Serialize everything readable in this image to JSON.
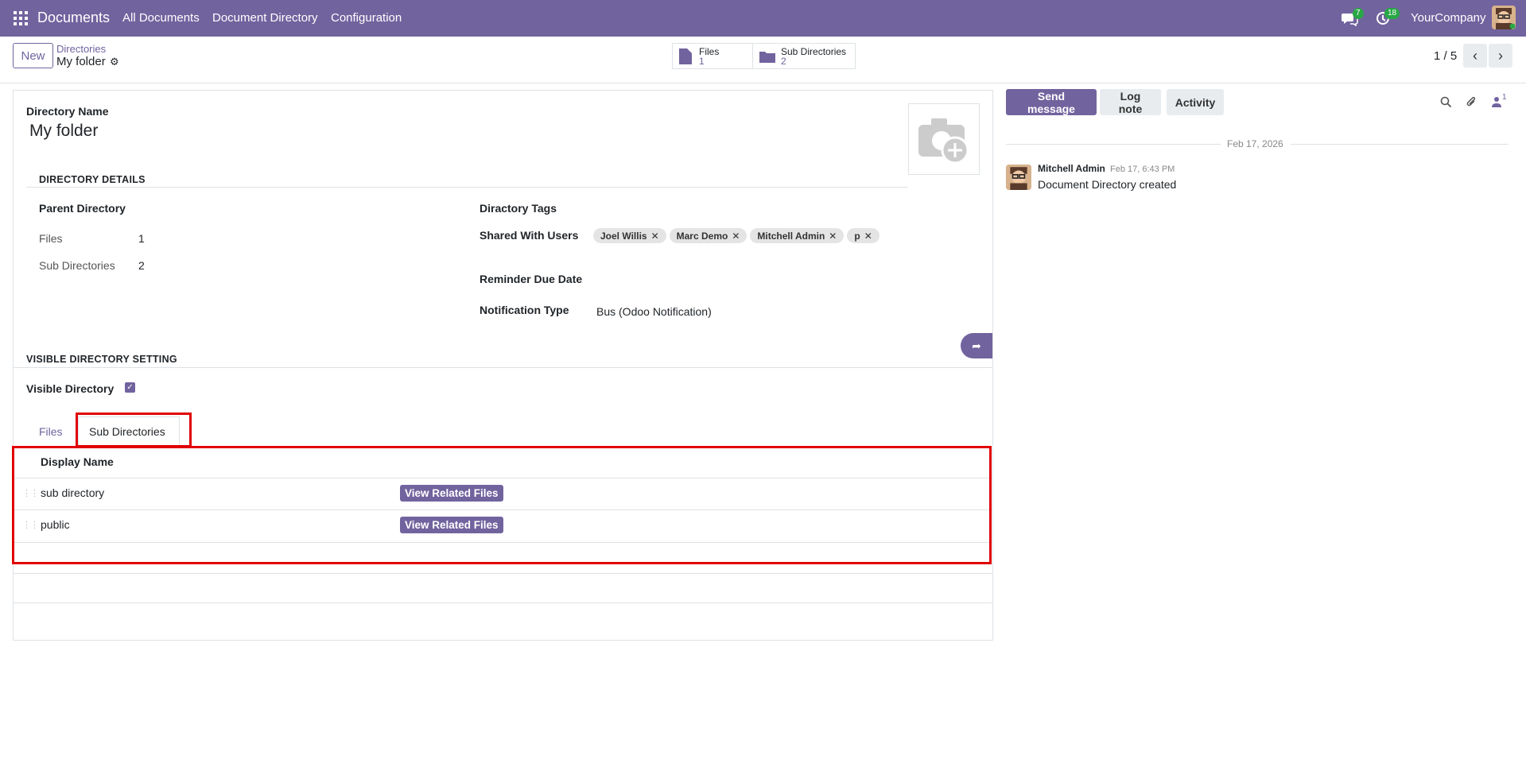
{
  "topbar": {
    "app_name": "Documents",
    "menus": [
      "All Documents",
      "Document Directory",
      "Configuration"
    ],
    "messages_badge": "7",
    "activities_badge": "18",
    "company": "YourCompany"
  },
  "control_panel": {
    "new_label": "New",
    "breadcrumb_parent": "Directories",
    "breadcrumb_current": "My folder",
    "smart_buttons": [
      {
        "label": "Files",
        "count": "1"
      },
      {
        "label": "Sub Directories",
        "count": "2"
      }
    ],
    "pager": "1 / 5"
  },
  "form": {
    "name_label": "Directory Name",
    "name_value": "My folder",
    "section_details": "DIRECTORY DETAILS",
    "parent_label": "Parent Directory",
    "files_label": "Files",
    "files_value": "1",
    "subdirs_label": "Sub Directories",
    "subdirs_value": "2",
    "tags_label": "Diractory Tags",
    "shared_label": "Shared With Users",
    "shared_users": [
      "Joel Willis",
      "Marc Demo",
      "Mitchell Admin",
      "p"
    ],
    "reminder_label": "Reminder Due Date",
    "notif_label": "Notification Type",
    "notif_value": "Bus (Odoo Notification)",
    "section_visible": "VISIBLE DIRECTORY SETTING",
    "visible_label": "Visible Directory",
    "visible_checked": true,
    "tabs": [
      "Files",
      "Sub Directories"
    ],
    "active_tab": "Sub Directories",
    "table_header": "Display Name",
    "rows": [
      {
        "name": "sub directory",
        "button": "View Related Files"
      },
      {
        "name": "public",
        "button": "View Related Files"
      }
    ]
  },
  "chatter": {
    "send_message": "Send message",
    "log_note": "Log note",
    "activity": "Activity",
    "followers_count": "1",
    "date_separator": "Feb 17, 2026",
    "message": {
      "author": "Mitchell Admin",
      "date": "Feb 17, 6:43 PM",
      "body": "Document Directory created"
    }
  },
  "colors": {
    "primary": "#71639e",
    "highlight": "#e00000"
  }
}
